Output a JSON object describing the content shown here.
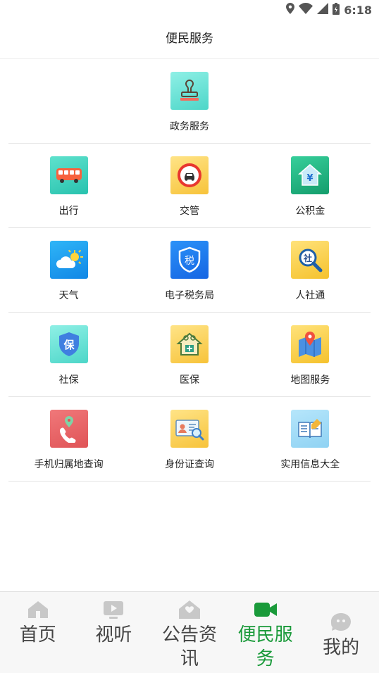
{
  "status_bar": {
    "time": "6:18",
    "icons": [
      "location-icon",
      "wifi-icon",
      "signal-icon",
      "battery-icon"
    ]
  },
  "header": {
    "title": "便民服务"
  },
  "services": {
    "top": {
      "label": "政务服务",
      "icon": "stamp-icon"
    },
    "rows": [
      [
        {
          "label": "出行",
          "icon": "bus-icon"
        },
        {
          "label": "交管",
          "icon": "traffic-car-icon"
        },
        {
          "label": "公积金",
          "icon": "housing-fund-icon"
        }
      ],
      [
        {
          "label": "天气",
          "icon": "weather-icon"
        },
        {
          "label": "电子税务局",
          "icon": "tax-shield-icon"
        },
        {
          "label": "人社通",
          "icon": "social-search-icon"
        }
      ],
      [
        {
          "label": "社保",
          "icon": "insurance-shield-icon"
        },
        {
          "label": "医保",
          "icon": "medical-house-icon"
        },
        {
          "label": "地图服务",
          "icon": "map-pin-icon"
        }
      ],
      [
        {
          "label": "手机归属地查询",
          "icon": "phone-location-icon"
        },
        {
          "label": "身份证查询",
          "icon": "id-card-search-icon"
        },
        {
          "label": "实用信息大全",
          "icon": "book-icon"
        }
      ]
    ],
    "top_glyph": "",
    "tile_glyphs": {
      "tax": "税",
      "social": "社",
      "insurance": "保",
      "fund": "¥"
    }
  },
  "bottom_nav": {
    "active_index": 3,
    "items": [
      {
        "label": "首页",
        "icon": "home-icon"
      },
      {
        "label": "视听",
        "icon": "play-icon"
      },
      {
        "label": "公告资讯",
        "icon": "notice-house-icon"
      },
      {
        "label": "便民服务",
        "icon": "video-camera-icon"
      },
      {
        "label": "我的",
        "icon": "profile-face-icon"
      }
    ]
  },
  "colors": {
    "active": "#1a9a3a",
    "inactive_icon": "#c8c8c8"
  }
}
